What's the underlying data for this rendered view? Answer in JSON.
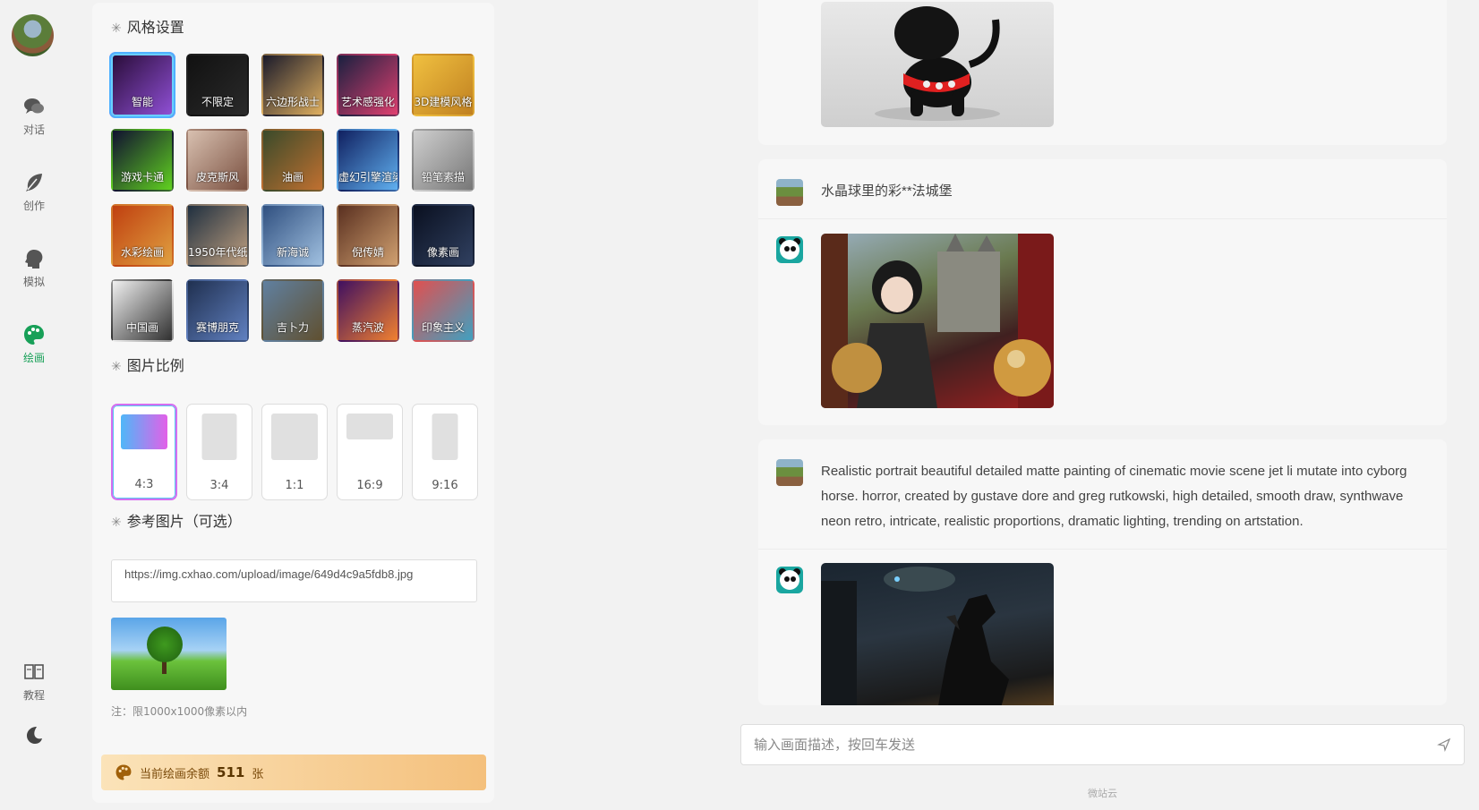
{
  "nav": {
    "items": [
      {
        "label": "对话",
        "icon": "chat-icon"
      },
      {
        "label": "创作",
        "icon": "feather-icon"
      },
      {
        "label": "模拟",
        "icon": "head-icon"
      },
      {
        "label": "绘画",
        "icon": "palette-icon"
      },
      {
        "label": "教程",
        "icon": "book-icon"
      }
    ],
    "theme_icon": "moon-icon",
    "active_color": "#18a058"
  },
  "style_section": {
    "title": "风格设置",
    "styles": [
      {
        "label": "智能",
        "colors": [
          "#2a0d3a",
          "#8f4fd4"
        ]
      },
      {
        "label": "不限定",
        "colors": [
          "#111111",
          "#2a2a2a"
        ]
      },
      {
        "label": "六边形战士",
        "colors": [
          "#1a1a2a",
          "#e0b060"
        ]
      },
      {
        "label": "艺术感强化",
        "colors": [
          "#1a2040",
          "#e04070"
        ]
      },
      {
        "label": "3D建模风格",
        "colors": [
          "#f0c040",
          "#c08020"
        ]
      },
      {
        "label": "游戏卡通",
        "colors": [
          "#101030",
          "#60d020"
        ]
      },
      {
        "label": "皮克斯风",
        "colors": [
          "#d8c0b0",
          "#7a5040"
        ]
      },
      {
        "label": "油画",
        "colors": [
          "#3a4a2a",
          "#c07030"
        ]
      },
      {
        "label": "虚幻引擎渲染",
        "colors": [
          "#102060",
          "#60b0f0"
        ]
      },
      {
        "label": "铅笔素描",
        "colors": [
          "#cfcfcf",
          "#777777"
        ]
      },
      {
        "label": "水彩绘画",
        "colors": [
          "#c04010",
          "#e0a040"
        ]
      },
      {
        "label": "1950年代纸艺",
        "colors": [
          "#203040",
          "#c0a080"
        ]
      },
      {
        "label": "新海诚",
        "colors": [
          "#305080",
          "#a0c0e0"
        ]
      },
      {
        "label": "倪传婧",
        "colors": [
          "#5a3020",
          "#d0a070"
        ]
      },
      {
        "label": "像素画",
        "colors": [
          "#0a1020",
          "#304060"
        ]
      },
      {
        "label": "中国画",
        "colors": [
          "#f0f0f0",
          "#303030"
        ]
      },
      {
        "label": "赛博朋克",
        "colors": [
          "#203050",
          "#6080c0"
        ]
      },
      {
        "label": "吉卜力",
        "colors": [
          "#6080a0",
          "#605030"
        ]
      },
      {
        "label": "蒸汽波",
        "colors": [
          "#401060",
          "#f08030"
        ]
      },
      {
        "label": "印象主义",
        "colors": [
          "#e05050",
          "#40a0c0"
        ]
      }
    ]
  },
  "ratio_section": {
    "title": "图片比例",
    "ratios": [
      "4:3",
      "3:4",
      "1:1",
      "16:9",
      "9:16"
    ],
    "selected": "4:3"
  },
  "reference_section": {
    "title": "参考图片（可选）",
    "url_value": "https://img.cxhao.com/upload/image/649d4c9a5fdb8.jpg",
    "note": "注：限1000x1000像素以内"
  },
  "balance": {
    "prefix": "当前绘画余额",
    "count": "511",
    "unit": "张"
  },
  "chat": {
    "messages": [
      {
        "role": "bot",
        "image_desc": "black puppy toy"
      },
      {
        "role": "user",
        "text": "水晶球里的彩**法城堡"
      },
      {
        "role": "bot",
        "image_desc": "anime girl castle crystal ball"
      },
      {
        "role": "user",
        "text": "Realistic portrait beautiful detailed matte painting of cinematic movie scene jet li mutate into cyborg horse. horror, created by gustave dore and greg rutkowski, high detailed, smooth draw, synthwave neon retro, intricate, realistic proportions, dramatic lighting, trending on artstation."
      },
      {
        "role": "bot",
        "image_desc": "cyborg horse dark scene"
      }
    ]
  },
  "composer": {
    "placeholder": "输入画面描述，按回车发送",
    "send_icon": "send-icon"
  },
  "footer": "微站云"
}
